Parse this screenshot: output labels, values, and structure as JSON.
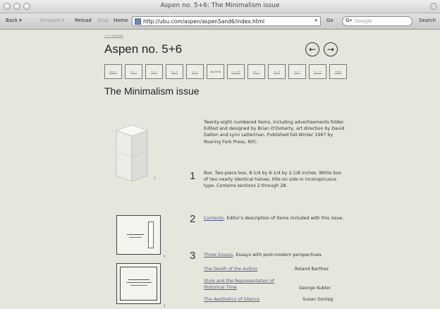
{
  "window": {
    "title": "Aspen no. 5+6: The Minimalism issue"
  },
  "toolbar": {
    "back": "Back",
    "forward": "Forward",
    "reload": "Reload",
    "stop": "Stop",
    "home": "Home",
    "url": "http://ubu.com/aspen/aspen5and6/index.html",
    "go": "Go",
    "search_placeholder": "Google",
    "search_label": "Search"
  },
  "page": {
    "back_link": "<< ubuweb",
    "title": "Aspen no. 5+6",
    "subtitle": "The Minimalism issue",
    "nav": [
      {
        "label": "aspen",
        "current": false
      },
      {
        "label": "no. 1",
        "current": false
      },
      {
        "label": "no. 2",
        "current": false
      },
      {
        "label": "no. 3",
        "current": false
      },
      {
        "label": "no. 4",
        "current": false
      },
      {
        "label": "no. 5+6",
        "current": true
      },
      {
        "label": "no. 5/6",
        "current": false
      },
      {
        "label": "no. 7",
        "current": false
      },
      {
        "label": "no. 8",
        "current": false
      },
      {
        "label": "no. 9",
        "current": false
      },
      {
        "label": "no. 10",
        "current": false
      },
      {
        "label": "index",
        "current": false
      }
    ],
    "intro": "Twenty-eight numbered items, including advertisements folder. Edited and designed by Brian O'Doherty, art direction by David Dalton and Lynn Letterman. Published Fall-Winter 1967 by Roaring Fork Press, NYC.",
    "items": [
      {
        "num": "1",
        "fig": "1",
        "link": "",
        "text": "Box. Two-piece box, 8-1/4 by 8-1/4 by 2-1/8 inches. White box of two nearly identical halves, title on side in inconspicuous type. Contains sections 2 through 28."
      },
      {
        "num": "2",
        "fig": "2",
        "link": "Contents",
        "text": ". Editor's description of items included with this issue."
      },
      {
        "num": "3",
        "fig": "3",
        "link": "Three Essays",
        "text": ". Essays with post-modern perspectives."
      }
    ],
    "essays": [
      {
        "title": "The Death of the Author",
        "author": "Roland Barthes"
      },
      {
        "title": "Style and the Representation of Historical Time",
        "author": "George Kubler"
      },
      {
        "title": "The Aesthetics of Silence",
        "author": "Susan Sontag"
      }
    ]
  }
}
